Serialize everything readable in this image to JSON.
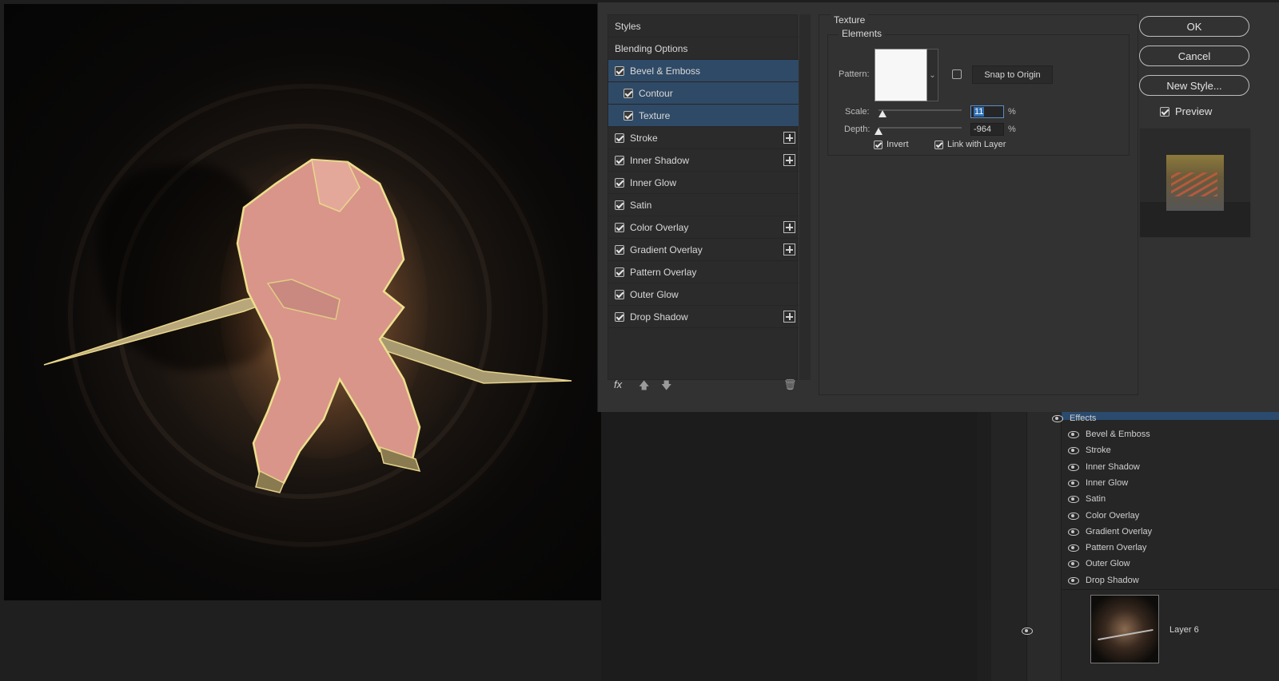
{
  "dialog": {
    "styles_list": [
      {
        "label": "Styles",
        "checkbox": false,
        "selected": false,
        "sub": false,
        "plus": false
      },
      {
        "label": "Blending Options",
        "checkbox": false,
        "selected": false,
        "sub": false,
        "plus": false
      },
      {
        "label": "Bevel & Emboss",
        "checkbox": true,
        "selected": true,
        "sub": false,
        "plus": false
      },
      {
        "label": "Contour",
        "checkbox": true,
        "selected": true,
        "sub": true,
        "plus": false
      },
      {
        "label": "Texture",
        "checkbox": true,
        "selected": true,
        "sub": true,
        "plus": false
      },
      {
        "label": "Stroke",
        "checkbox": true,
        "selected": false,
        "sub": false,
        "plus": true
      },
      {
        "label": "Inner Shadow",
        "checkbox": true,
        "selected": false,
        "sub": false,
        "plus": true
      },
      {
        "label": "Inner Glow",
        "checkbox": true,
        "selected": false,
        "sub": false,
        "plus": false
      },
      {
        "label": "Satin",
        "checkbox": true,
        "selected": false,
        "sub": false,
        "plus": false
      },
      {
        "label": "Color Overlay",
        "checkbox": true,
        "selected": false,
        "sub": false,
        "plus": true
      },
      {
        "label": "Gradient Overlay",
        "checkbox": true,
        "selected": false,
        "sub": false,
        "plus": true
      },
      {
        "label": "Pattern Overlay",
        "checkbox": true,
        "selected": false,
        "sub": false,
        "plus": false
      },
      {
        "label": "Outer Glow",
        "checkbox": true,
        "selected": false,
        "sub": false,
        "plus": false
      },
      {
        "label": "Drop Shadow",
        "checkbox": true,
        "selected": false,
        "sub": false,
        "plus": true
      }
    ],
    "footer": {
      "fx": "fx"
    },
    "texture": {
      "title": "Texture",
      "elements_title": "Elements",
      "pattern_label": "Pattern:",
      "snap_label": "Snap to Origin",
      "scale_label": "Scale:",
      "scale_value": "11",
      "depth_label": "Depth:",
      "depth_value": "-964",
      "percent": "%",
      "invert_label": "Invert",
      "link_label": "Link with Layer"
    },
    "buttons": {
      "ok": "OK",
      "cancel": "Cancel",
      "new_style": "New Style..."
    },
    "preview_label": "Preview"
  },
  "layers": {
    "effects_label": "Effects",
    "effects": [
      "Bevel & Emboss",
      "Stroke",
      "Inner Shadow",
      "Inner Glow",
      "Satin",
      "Color Overlay",
      "Gradient Overlay",
      "Pattern Overlay",
      "Outer Glow",
      "Drop Shadow"
    ],
    "layer_name": "Layer 6"
  },
  "colors": {
    "selection": "#2f4a66",
    "panel": "#323232",
    "accent": "#2f6fb4"
  }
}
